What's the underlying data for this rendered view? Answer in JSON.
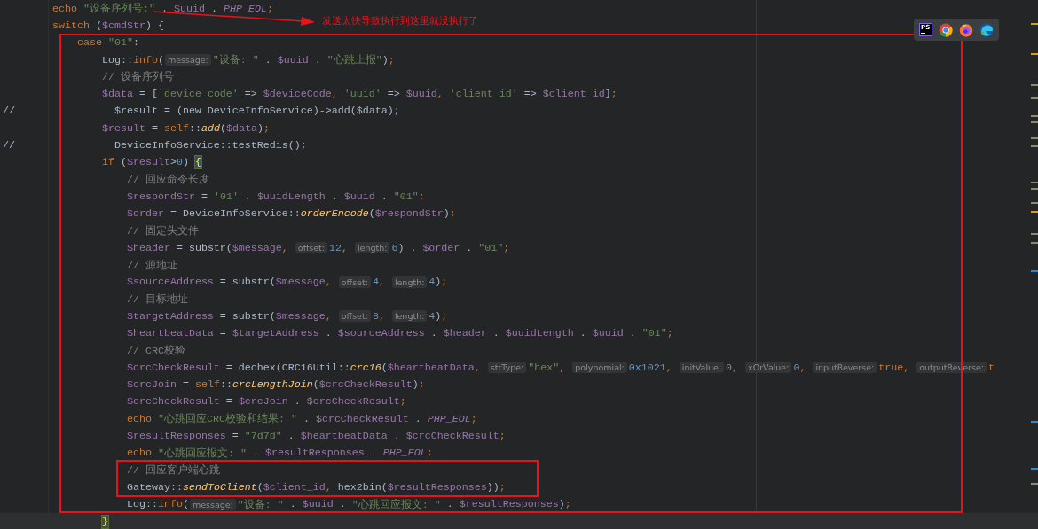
{
  "editor": {
    "lines": [
      {
        "tokens": [
          {
            "kind": "keyword",
            "text": "echo "
          },
          {
            "kind": "string",
            "text": "\"设备序列号:\""
          },
          {
            "kind": "plain",
            "text": " . "
          },
          {
            "kind": "variable",
            "text": "$uuid"
          },
          {
            "kind": "plain",
            "text": " . "
          },
          {
            "kind": "constant",
            "text": "PHP_EOL"
          },
          {
            "kind": "punct",
            "text": ";"
          }
        ]
      },
      {
        "tokens": [
          {
            "kind": "keyword",
            "text": "switch "
          },
          {
            "kind": "plain",
            "text": "("
          },
          {
            "kind": "variable",
            "text": "$cmdStr"
          },
          {
            "kind": "plain",
            "text": ") {"
          }
        ],
        "children": [
          {
            "tokens": [
              {
                "kind": "keyword",
                "text": "case "
              },
              {
                "kind": "string",
                "text": "\"01\""
              },
              {
                "kind": "plain",
                "text": ":"
              }
            ],
            "children": [
              {
                "tokens": [
                  {
                    "kind": "plain",
                    "text": "Log::"
                  },
                  {
                    "kind": "call",
                    "text": "info"
                  },
                  {
                    "kind": "plain",
                    "text": "("
                  },
                  {
                    "kind": "hint",
                    "text": "message:"
                  },
                  {
                    "kind": "string",
                    "text": "\"设备: \""
                  },
                  {
                    "kind": "plain",
                    "text": " . "
                  },
                  {
                    "kind": "variable",
                    "text": "$uuid"
                  },
                  {
                    "kind": "plain",
                    "text": " . "
                  },
                  {
                    "kind": "string",
                    "text": "\"心跳上报\""
                  },
                  {
                    "kind": "plain",
                    "text": ")"
                  },
                  {
                    "kind": "punct",
                    "text": ";"
                  }
                ]
              },
              {
                "tokens": [
                  {
                    "kind": "comment",
                    "text": "// 设备序列号"
                  }
                ]
              },
              {
                "tokens": [
                  {
                    "kind": "variable",
                    "text": "$data"
                  },
                  {
                    "kind": "plain",
                    "text": " = ["
                  },
                  {
                    "kind": "string",
                    "text": "'device_code'"
                  },
                  {
                    "kind": "plain",
                    "text": " => "
                  },
                  {
                    "kind": "variable",
                    "text": "$deviceCode"
                  },
                  {
                    "kind": "punct",
                    "text": ", "
                  },
                  {
                    "kind": "string",
                    "text": "'uuid'"
                  },
                  {
                    "kind": "plain",
                    "text": " => "
                  },
                  {
                    "kind": "variable",
                    "text": "$uuid"
                  },
                  {
                    "kind": "punct",
                    "text": ", "
                  },
                  {
                    "kind": "string",
                    "text": "'client_id'"
                  },
                  {
                    "kind": "plain",
                    "text": " => "
                  },
                  {
                    "kind": "variable",
                    "text": "$client_id"
                  },
                  {
                    "kind": "plain",
                    "text": "]"
                  },
                  {
                    "kind": "punct",
                    "text": ";"
                  }
                ]
              },
              {
                "comment_mark": "//",
                "tokens": [
                  {
                    "kind": "plain",
                    "text": "$result = (new DeviceInfoService)->add($data);"
                  }
                ]
              },
              {
                "tokens": [
                  {
                    "kind": "variable",
                    "text": "$result"
                  },
                  {
                    "kind": "plain",
                    "text": " = "
                  },
                  {
                    "kind": "keyword",
                    "text": "self"
                  },
                  {
                    "kind": "plain",
                    "text": "::"
                  },
                  {
                    "kind": "method",
                    "text": "add"
                  },
                  {
                    "kind": "plain",
                    "text": "("
                  },
                  {
                    "kind": "variable",
                    "text": "$data"
                  },
                  {
                    "kind": "plain",
                    "text": ")"
                  },
                  {
                    "kind": "punct",
                    "text": ";"
                  }
                ]
              },
              {
                "comment_mark": "//",
                "tokens": [
                  {
                    "kind": "plain",
                    "text": "DeviceInfoService::testRedis();"
                  }
                ]
              },
              {
                "tokens": [
                  {
                    "kind": "keyword",
                    "text": "if "
                  },
                  {
                    "kind": "plain",
                    "text": "("
                  },
                  {
                    "kind": "variable",
                    "text": "$result"
                  },
                  {
                    "kind": "plain",
                    "text": ">"
                  },
                  {
                    "kind": "number",
                    "text": "0"
                  },
                  {
                    "kind": "plain",
                    "text": ") "
                  },
                  {
                    "kind": "brace",
                    "text": "{",
                    "matched": true
                  }
                ],
                "children": [
                  {
                    "tokens": [
                      {
                        "kind": "comment",
                        "text": "// 回应命令长度"
                      }
                    ]
                  },
                  {
                    "tokens": [
                      {
                        "kind": "variable",
                        "text": "$respondStr"
                      },
                      {
                        "kind": "plain",
                        "text": " = "
                      },
                      {
                        "kind": "string",
                        "text": "'01'"
                      },
                      {
                        "kind": "plain",
                        "text": " . "
                      },
                      {
                        "kind": "variable",
                        "text": "$uuidLength"
                      },
                      {
                        "kind": "plain",
                        "text": " . "
                      },
                      {
                        "kind": "variable",
                        "text": "$uuid"
                      },
                      {
                        "kind": "plain",
                        "text": " . "
                      },
                      {
                        "kind": "string",
                        "text": "\"01\""
                      },
                      {
                        "kind": "punct",
                        "text": ";"
                      }
                    ]
                  },
                  {
                    "tokens": [
                      {
                        "kind": "variable",
                        "text": "$order"
                      },
                      {
                        "kind": "plain",
                        "text": " = DeviceInfoService::"
                      },
                      {
                        "kind": "method",
                        "text": "orderEncode"
                      },
                      {
                        "kind": "plain",
                        "text": "("
                      },
                      {
                        "kind": "variable",
                        "text": "$respondStr"
                      },
                      {
                        "kind": "plain",
                        "text": ")"
                      },
                      {
                        "kind": "punct",
                        "text": ";"
                      }
                    ]
                  },
                  {
                    "tokens": [
                      {
                        "kind": "comment",
                        "text": "// 固定头文件"
                      }
                    ]
                  },
                  {
                    "tokens": [
                      {
                        "kind": "variable",
                        "text": "$header"
                      },
                      {
                        "kind": "plain",
                        "text": " = substr("
                      },
                      {
                        "kind": "variable",
                        "text": "$message"
                      },
                      {
                        "kind": "punct",
                        "text": ", "
                      },
                      {
                        "kind": "hint",
                        "text": "offset:"
                      },
                      {
                        "kind": "number",
                        "text": "12"
                      },
                      {
                        "kind": "punct",
                        "text": ", "
                      },
                      {
                        "kind": "hint",
                        "text": "length:"
                      },
                      {
                        "kind": "number",
                        "text": "6"
                      },
                      {
                        "kind": "plain",
                        "text": ") . "
                      },
                      {
                        "kind": "variable",
                        "text": "$order"
                      },
                      {
                        "kind": "plain",
                        "text": " . "
                      },
                      {
                        "kind": "string",
                        "text": "\"01\""
                      },
                      {
                        "kind": "punct",
                        "text": ";"
                      }
                    ]
                  },
                  {
                    "tokens": [
                      {
                        "kind": "comment",
                        "text": "// 源地址"
                      }
                    ]
                  },
                  {
                    "tokens": [
                      {
                        "kind": "variable",
                        "text": "$sourceAddress"
                      },
                      {
                        "kind": "plain",
                        "text": " = substr("
                      },
                      {
                        "kind": "variable",
                        "text": "$message"
                      },
                      {
                        "kind": "punct",
                        "text": ", "
                      },
                      {
                        "kind": "hint",
                        "text": "offset:"
                      },
                      {
                        "kind": "number",
                        "text": "4"
                      },
                      {
                        "kind": "punct",
                        "text": ", "
                      },
                      {
                        "kind": "hint",
                        "text": "length:"
                      },
                      {
                        "kind": "number",
                        "text": "4"
                      },
                      {
                        "kind": "plain",
                        "text": ")"
                      },
                      {
                        "kind": "punct",
                        "text": ";"
                      }
                    ]
                  },
                  {
                    "tokens": [
                      {
                        "kind": "comment",
                        "text": "// 目标地址"
                      }
                    ]
                  },
                  {
                    "tokens": [
                      {
                        "kind": "variable",
                        "text": "$targetAddress"
                      },
                      {
                        "kind": "plain",
                        "text": " = substr("
                      },
                      {
                        "kind": "variable",
                        "text": "$message"
                      },
                      {
                        "kind": "punct",
                        "text": ", "
                      },
                      {
                        "kind": "hint",
                        "text": "offset:"
                      },
                      {
                        "kind": "number",
                        "text": "8"
                      },
                      {
                        "kind": "punct",
                        "text": ", "
                      },
                      {
                        "kind": "hint",
                        "text": "length:"
                      },
                      {
                        "kind": "number",
                        "text": "4"
                      },
                      {
                        "kind": "plain",
                        "text": ")"
                      },
                      {
                        "kind": "punct",
                        "text": ";"
                      }
                    ]
                  },
                  {
                    "tokens": [
                      {
                        "kind": "variable",
                        "text": "$heartbeatData"
                      },
                      {
                        "kind": "plain",
                        "text": " = "
                      },
                      {
                        "kind": "variable",
                        "text": "$targetAddress"
                      },
                      {
                        "kind": "plain",
                        "text": " . "
                      },
                      {
                        "kind": "variable",
                        "text": "$sourceAddress"
                      },
                      {
                        "kind": "plain",
                        "text": " . "
                      },
                      {
                        "kind": "variable",
                        "text": "$header"
                      },
                      {
                        "kind": "plain",
                        "text": " . "
                      },
                      {
                        "kind": "variable",
                        "text": "$uuidLength"
                      },
                      {
                        "kind": "plain",
                        "text": " . "
                      },
                      {
                        "kind": "variable",
                        "text": "$uuid"
                      },
                      {
                        "kind": "plain",
                        "text": " . "
                      },
                      {
                        "kind": "string",
                        "text": "\"01\""
                      },
                      {
                        "kind": "punct",
                        "text": ";"
                      }
                    ]
                  },
                  {
                    "tokens": [
                      {
                        "kind": "comment",
                        "text": "// CRC校验"
                      }
                    ]
                  },
                  {
                    "tokens": [
                      {
                        "kind": "variable",
                        "text": "$crcCheckResult"
                      },
                      {
                        "kind": "plain",
                        "text": " = dechex(CRC16Util::"
                      },
                      {
                        "kind": "method",
                        "text": "crc16"
                      },
                      {
                        "kind": "plain",
                        "text": "("
                      },
                      {
                        "kind": "variable",
                        "text": "$heartbeatData"
                      },
                      {
                        "kind": "punct",
                        "text": ", "
                      },
                      {
                        "kind": "hint",
                        "text": "strType:"
                      },
                      {
                        "kind": "string",
                        "text": "\"hex\""
                      },
                      {
                        "kind": "punct",
                        "text": ", "
                      },
                      {
                        "kind": "hint",
                        "text": "polynomial:"
                      },
                      {
                        "kind": "number",
                        "text": "0x1021"
                      },
                      {
                        "kind": "punct",
                        "text": ", "
                      },
                      {
                        "kind": "hint",
                        "text": "initValue:"
                      },
                      {
                        "kind": "number",
                        "text": "0"
                      },
                      {
                        "kind": "punct",
                        "text": ", "
                      },
                      {
                        "kind": "hint",
                        "text": "xOrValue:"
                      },
                      {
                        "kind": "number",
                        "text": "0"
                      },
                      {
                        "kind": "punct",
                        "text": ", "
                      },
                      {
                        "kind": "hint",
                        "text": "inputReverse:"
                      },
                      {
                        "kind": "keyword",
                        "text": "true"
                      },
                      {
                        "kind": "punct",
                        "text": ", "
                      },
                      {
                        "kind": "hint",
                        "text": "outputReverse:"
                      },
                      {
                        "kind": "keyword",
                        "text": "t"
                      }
                    ]
                  },
                  {
                    "tokens": [
                      {
                        "kind": "variable",
                        "text": "$crcJoin"
                      },
                      {
                        "kind": "plain",
                        "text": " = "
                      },
                      {
                        "kind": "keyword",
                        "text": "self"
                      },
                      {
                        "kind": "plain",
                        "text": "::"
                      },
                      {
                        "kind": "method",
                        "text": "crcLengthJoin"
                      },
                      {
                        "kind": "plain",
                        "text": "("
                      },
                      {
                        "kind": "variable",
                        "text": "$crcCheckResult"
                      },
                      {
                        "kind": "plain",
                        "text": ")"
                      },
                      {
                        "kind": "punct",
                        "text": ";"
                      }
                    ]
                  },
                  {
                    "tokens": [
                      {
                        "kind": "variable",
                        "text": "$crcCheckResult"
                      },
                      {
                        "kind": "plain",
                        "text": " = "
                      },
                      {
                        "kind": "variable",
                        "text": "$crcJoin"
                      },
                      {
                        "kind": "plain",
                        "text": " . "
                      },
                      {
                        "kind": "variable",
                        "text": "$crcCheckResult"
                      },
                      {
                        "kind": "punct",
                        "text": ";"
                      }
                    ]
                  },
                  {
                    "tokens": [
                      {
                        "kind": "keyword",
                        "text": "echo "
                      },
                      {
                        "kind": "string",
                        "text": "\"心跳回应CRC校验和结果: \""
                      },
                      {
                        "kind": "plain",
                        "text": " . "
                      },
                      {
                        "kind": "variable",
                        "text": "$crcCheckResult"
                      },
                      {
                        "kind": "plain",
                        "text": " . "
                      },
                      {
                        "kind": "constant",
                        "text": "PHP_EOL"
                      },
                      {
                        "kind": "punct",
                        "text": ";"
                      }
                    ]
                  },
                  {
                    "tokens": [
                      {
                        "kind": "variable",
                        "text": "$resultResponses"
                      },
                      {
                        "kind": "plain",
                        "text": " = "
                      },
                      {
                        "kind": "string",
                        "text": "\"7d7d\""
                      },
                      {
                        "kind": "plain",
                        "text": " . "
                      },
                      {
                        "kind": "variable",
                        "text": "$heartbeatData"
                      },
                      {
                        "kind": "plain",
                        "text": " . "
                      },
                      {
                        "kind": "variable",
                        "text": "$crcCheckResult"
                      },
                      {
                        "kind": "punct",
                        "text": ";"
                      }
                    ]
                  },
                  {
                    "tokens": [
                      {
                        "kind": "keyword",
                        "text": "echo "
                      },
                      {
                        "kind": "string",
                        "text": "\"心跳回应报文: \""
                      },
                      {
                        "kind": "plain",
                        "text": " . "
                      },
                      {
                        "kind": "variable",
                        "text": "$resultResponses"
                      },
                      {
                        "kind": "plain",
                        "text": " . "
                      },
                      {
                        "kind": "constant",
                        "text": "PHP_EOL"
                      },
                      {
                        "kind": "punct",
                        "text": ";"
                      }
                    ]
                  },
                  {
                    "tokens": [
                      {
                        "kind": "comment",
                        "text": "// 回应客户端心跳"
                      }
                    ]
                  },
                  {
                    "tokens": [
                      {
                        "kind": "plain",
                        "text": "Gateway::"
                      },
                      {
                        "kind": "method",
                        "text": "sendToClient"
                      },
                      {
                        "kind": "plain",
                        "text": "("
                      },
                      {
                        "kind": "variable",
                        "text": "$client_id"
                      },
                      {
                        "kind": "punct",
                        "text": ", "
                      },
                      {
                        "kind": "plain",
                        "text": "hex2bin("
                      },
                      {
                        "kind": "variable",
                        "text": "$resultResponses"
                      },
                      {
                        "kind": "plain",
                        "text": "))"
                      },
                      {
                        "kind": "punct",
                        "text": ";"
                      }
                    ]
                  },
                  {
                    "tokens": [
                      {
                        "kind": "plain",
                        "text": "Log::"
                      },
                      {
                        "kind": "call",
                        "text": "info"
                      },
                      {
                        "kind": "plain",
                        "text": "("
                      },
                      {
                        "kind": "hint",
                        "text": "message:"
                      },
                      {
                        "kind": "string",
                        "text": "\"设备: \""
                      },
                      {
                        "kind": "plain",
                        "text": " . "
                      },
                      {
                        "kind": "variable",
                        "text": "$uuid"
                      },
                      {
                        "kind": "plain",
                        "text": " . "
                      },
                      {
                        "kind": "string",
                        "text": "\"心跳回应报文: \""
                      },
                      {
                        "kind": "plain",
                        "text": " . "
                      },
                      {
                        "kind": "variable",
                        "text": "$resultResponses"
                      },
                      {
                        "kind": "plain",
                        "text": ")"
                      },
                      {
                        "kind": "punct",
                        "text": ";"
                      }
                    ]
                  }
                ]
              },
              {
                "current": true,
                "tokens": [
                  {
                    "kind": "brace",
                    "text": "}",
                    "matched": true
                  }
                ]
              }
            ]
          }
        ]
      }
    ]
  },
  "browser_toolbar": {
    "items": [
      {
        "kind": "ide",
        "label": "PS"
      },
      {
        "kind": "chrome"
      },
      {
        "kind": "firefox"
      },
      {
        "kind": "edge"
      }
    ]
  },
  "annotation": {
    "note": "发送太快导致执行到这里就没执行了"
  }
}
